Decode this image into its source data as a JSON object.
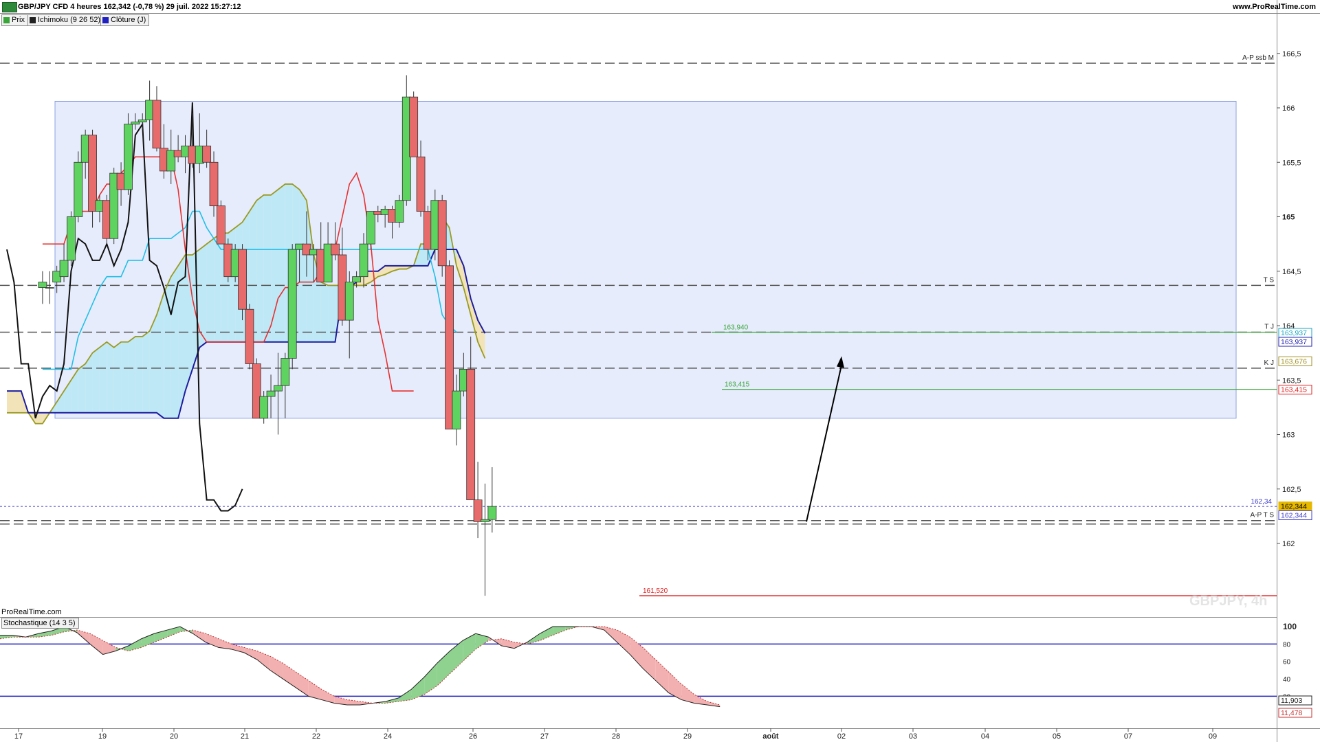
{
  "header": {
    "title": "GBP/JPY CFD 4 heures 162,342 (-0,78 %) 29 juil. 2022 15:27:12",
    "brand": "www.ProRealTime.com",
    "legend": [
      {
        "label": "Prix",
        "color": "#3aa63a"
      },
      {
        "label": "Ichimoku (9 26 52)",
        "color": "#222222"
      },
      {
        "label": "Clôture (J)",
        "color": "#2020c0"
      }
    ]
  },
  "footer": {
    "prorealtime": "ProRealTime.com",
    "watermark": "GBPJPY, 4h"
  },
  "stochastic": {
    "label": "Stochastique (14 3 5)",
    "levels": {
      "upper": 80,
      "lower": 20
    },
    "ticks": [
      "100",
      "80",
      "60",
      "40",
      "20"
    ],
    "value_k": "11,903",
    "value_d": "11,478",
    "k": [
      90,
      90,
      88,
      92,
      95,
      100,
      93,
      80,
      68,
      72,
      78,
      86,
      92,
      96,
      100,
      92,
      82,
      76,
      74,
      70,
      62,
      50,
      40,
      30,
      20,
      16,
      12,
      10,
      10,
      12,
      14,
      18,
      28,
      42,
      58,
      72,
      84,
      92,
      88,
      78,
      75,
      82,
      92,
      100,
      100,
      100,
      100,
      96,
      82,
      68,
      52,
      38,
      24,
      16,
      12,
      10,
      8
    ],
    "d": [
      86,
      88,
      88,
      88,
      90,
      94,
      96,
      92,
      84,
      76,
      72,
      76,
      82,
      88,
      94,
      96,
      92,
      86,
      80,
      76,
      72,
      66,
      58,
      48,
      38,
      28,
      20,
      16,
      14,
      12,
      12,
      14,
      16,
      22,
      32,
      46,
      60,
      74,
      84,
      86,
      82,
      80,
      84,
      90,
      96,
      100,
      100,
      100,
      96,
      88,
      76,
      62,
      48,
      34,
      22,
      14,
      10
    ]
  },
  "price_axis": {
    "ticks": [
      "166,5",
      "166",
      "165,5",
      "165",
      "164,5",
      "164",
      "163,5",
      "163",
      "162,5",
      "162"
    ],
    "bold_ticks": [
      "165"
    ]
  },
  "x_axis": {
    "labels": [
      "17",
      "19",
      "20",
      "21",
      "22",
      "24",
      "26",
      "27",
      "28",
      "29",
      "août",
      "02",
      "03",
      "04",
      "05",
      "07",
      "09"
    ]
  },
  "chart_data": {
    "type": "candlestick",
    "symbol": "GBP/JPY",
    "timeframe": "4 heures",
    "ylim": [
      161.4,
      166.85
    ],
    "candles": [
      {
        "o": 164.35,
        "h": 164.5,
        "l": 164.2,
        "c": 164.4
      },
      {
        "o": 164.35,
        "h": 164.5,
        "l": 164.2,
        "c": 164.35
      },
      {
        "o": 164.4,
        "h": 164.55,
        "l": 164.3,
        "c": 164.5
      },
      {
        "o": 164.45,
        "h": 164.75,
        "l": 164.4,
        "c": 164.6
      },
      {
        "o": 164.6,
        "h": 165.05,
        "l": 164.55,
        "c": 165.0
      },
      {
        "o": 165.0,
        "h": 165.6,
        "l": 164.95,
        "c": 165.5
      },
      {
        "o": 165.5,
        "h": 165.8,
        "l": 165.35,
        "c": 165.75
      },
      {
        "o": 165.75,
        "h": 165.8,
        "l": 164.9,
        "c": 165.05
      },
      {
        "o": 165.05,
        "h": 165.2,
        "l": 164.95,
        "c": 165.15
      },
      {
        "o": 165.15,
        "h": 165.2,
        "l": 164.75,
        "c": 164.8
      },
      {
        "o": 164.8,
        "h": 165.45,
        "l": 164.75,
        "c": 165.4
      },
      {
        "o": 165.4,
        "h": 165.5,
        "l": 165.1,
        "c": 165.25
      },
      {
        "o": 165.25,
        "h": 165.95,
        "l": 165.2,
        "c": 165.85
      },
      {
        "o": 165.85,
        "h": 165.95,
        "l": 165.8,
        "c": 165.87
      },
      {
        "o": 165.87,
        "h": 165.95,
        "l": 165.8,
        "c": 165.89
      },
      {
        "o": 165.89,
        "h": 166.25,
        "l": 165.7,
        "c": 166.07
      },
      {
        "o": 166.07,
        "h": 166.2,
        "l": 165.6,
        "c": 165.63
      },
      {
        "o": 165.63,
        "h": 165.85,
        "l": 165.35,
        "c": 165.42
      },
      {
        "o": 165.42,
        "h": 165.8,
        "l": 165.3,
        "c": 165.61
      },
      {
        "o": 165.61,
        "h": 165.75,
        "l": 165.5,
        "c": 165.55
      },
      {
        "o": 165.55,
        "h": 165.75,
        "l": 165.4,
        "c": 165.65
      },
      {
        "o": 165.65,
        "h": 165.95,
        "l": 165.45,
        "c": 165.49
      },
      {
        "o": 165.49,
        "h": 165.95,
        "l": 165.4,
        "c": 165.65
      },
      {
        "o": 165.65,
        "h": 165.8,
        "l": 165.45,
        "c": 165.5
      },
      {
        "o": 165.5,
        "h": 165.6,
        "l": 165.0,
        "c": 165.1
      },
      {
        "o": 165.1,
        "h": 165.15,
        "l": 164.75,
        "c": 164.75
      },
      {
        "o": 164.75,
        "h": 164.8,
        "l": 164.4,
        "c": 164.45
      },
      {
        "o": 164.45,
        "h": 164.75,
        "l": 164.4,
        "c": 164.7
      },
      {
        "o": 164.7,
        "h": 164.75,
        "l": 164.05,
        "c": 164.15
      },
      {
        "o": 164.15,
        "h": 164.2,
        "l": 163.6,
        "c": 163.65
      },
      {
        "o": 163.65,
        "h": 163.7,
        "l": 163.15,
        "c": 163.15
      },
      {
        "o": 163.15,
        "h": 163.4,
        "l": 163.1,
        "c": 163.35
      },
      {
        "o": 163.35,
        "h": 163.55,
        "l": 163.15,
        "c": 163.4
      },
      {
        "o": 163.4,
        "h": 163.75,
        "l": 163.0,
        "c": 163.45
      },
      {
        "o": 163.45,
        "h": 163.75,
        "l": 163.15,
        "c": 163.7
      },
      {
        "o": 163.7,
        "h": 164.75,
        "l": 163.6,
        "c": 164.7
      },
      {
        "o": 164.7,
        "h": 164.75,
        "l": 164.4,
        "c": 164.75
      },
      {
        "o": 164.75,
        "h": 165.05,
        "l": 164.45,
        "c": 164.65
      },
      {
        "o": 164.65,
        "h": 164.75,
        "l": 164.4,
        "c": 164.7
      },
      {
        "o": 164.7,
        "h": 164.95,
        "l": 164.5,
        "c": 164.4
      },
      {
        "o": 164.4,
        "h": 164.95,
        "l": 164.4,
        "c": 164.75
      },
      {
        "o": 164.75,
        "h": 164.95,
        "l": 164.6,
        "c": 164.65
      },
      {
        "o": 164.65,
        "h": 164.9,
        "l": 164.0,
        "c": 164.05
      },
      {
        "o": 164.05,
        "h": 164.5,
        "l": 163.7,
        "c": 164.4
      },
      {
        "o": 164.4,
        "h": 164.5,
        "l": 164.35,
        "c": 164.45
      },
      {
        "o": 164.45,
        "h": 164.85,
        "l": 164.35,
        "c": 164.75
      },
      {
        "o": 164.75,
        "h": 165.05,
        "l": 164.7,
        "c": 165.05
      },
      {
        "o": 165.05,
        "h": 165.1,
        "l": 164.95,
        "c": 165.02
      },
      {
        "o": 165.02,
        "h": 165.1,
        "l": 164.9,
        "c": 165.07
      },
      {
        "o": 165.07,
        "h": 165.1,
        "l": 164.8,
        "c": 164.95
      },
      {
        "o": 164.95,
        "h": 165.2,
        "l": 164.9,
        "c": 165.15
      },
      {
        "o": 165.15,
        "h": 166.3,
        "l": 165.1,
        "c": 166.1
      },
      {
        "o": 166.1,
        "h": 166.15,
        "l": 165.55,
        "c": 165.55
      },
      {
        "o": 165.55,
        "h": 165.7,
        "l": 165.0,
        "c": 165.05
      },
      {
        "o": 165.05,
        "h": 165.1,
        "l": 164.6,
        "c": 164.7
      },
      {
        "o": 164.7,
        "h": 165.25,
        "l": 164.6,
        "c": 165.15
      },
      {
        "o": 165.15,
        "h": 165.2,
        "l": 164.45,
        "c": 164.55
      },
      {
        "o": 164.55,
        "h": 164.6,
        "l": 163.05,
        "c": 163.05
      },
      {
        "o": 163.05,
        "h": 163.55,
        "l": 162.9,
        "c": 163.4
      },
      {
        "o": 163.4,
        "h": 163.75,
        "l": 163.35,
        "c": 163.6
      },
      {
        "o": 163.6,
        "h": 163.9,
        "l": 162.4,
        "c": 162.4
      },
      {
        "o": 162.4,
        "h": 162.75,
        "l": 162.05,
        "c": 162.2
      },
      {
        "o": 162.2,
        "h": 162.55,
        "l": 161.52,
        "c": 162.22
      },
      {
        "o": 162.22,
        "h": 162.7,
        "l": 162.1,
        "c": 162.34
      }
    ],
    "tenkan": [
      164.75,
      164.75,
      164.75,
      164.75,
      164.95,
      165.05,
      165.05,
      165.05,
      165.2,
      165.3,
      165.3,
      165.4,
      165.47,
      165.55,
      165.55,
      165.55,
      165.55,
      165.55,
      165.55,
      165.25,
      164.7,
      164.25,
      163.95,
      163.85,
      163.85,
      163.85,
      163.85,
      163.85,
      163.85,
      163.85,
      163.85,
      163.85,
      164.0,
      164.25,
      164.35,
      164.35,
      164.4,
      164.4,
      164.4,
      164.5,
      164.6,
      164.7,
      165.0,
      165.3,
      165.4,
      165.2,
      164.75,
      164.05,
      163.75,
      163.4,
      163.4,
      163.4,
      163.4
    ],
    "kijun": [
      163.6,
      163.6,
      163.6,
      163.6,
      163.6,
      163.9,
      164.05,
      164.2,
      164.35,
      164.45,
      164.45,
      164.45,
      164.6,
      164.6,
      164.6,
      164.8,
      164.8,
      164.8,
      164.8,
      164.85,
      164.9,
      165.05,
      165.05,
      164.9,
      164.8,
      164.7,
      164.7,
      164.7,
      164.7,
      164.7,
      164.7,
      164.7,
      164.7,
      164.7,
      164.7,
      164.7,
      164.7,
      164.7,
      164.7,
      164.7,
      164.7,
      164.7,
      164.7,
      164.7,
      164.7,
      164.7,
      164.7,
      164.7,
      164.7,
      164.7,
      164.7,
      164.7,
      164.7,
      164.7,
      164.7,
      164.45,
      164.1,
      164.0,
      163.94
    ],
    "chikou": [
      164.7,
      164.4,
      163.65,
      163.65,
      163.15,
      163.35,
      163.45,
      163.4,
      163.65,
      164.5,
      164.8,
      164.75,
      164.6,
      164.6,
      164.75,
      164.55,
      164.7,
      164.95,
      165.75,
      165.85,
      164.6,
      164.55,
      164.35,
      164.1,
      164.4,
      164.45,
      166.05,
      163.1,
      162.4,
      162.4,
      162.3,
      162.3,
      162.35,
      162.5
    ],
    "ssa": [
      163.2,
      163.2,
      163.2,
      163.2,
      163.1,
      163.1,
      163.2,
      163.3,
      163.4,
      163.5,
      163.6,
      163.65,
      163.75,
      163.8,
      163.85,
      163.8,
      163.85,
      163.85,
      163.9,
      163.9,
      163.95,
      164.1,
      164.3,
      164.45,
      164.55,
      164.65,
      164.65,
      164.7,
      164.75,
      164.8,
      164.85,
      164.85,
      164.9,
      164.95,
      165.05,
      165.15,
      165.2,
      165.2,
      165.25,
      165.3,
      165.3,
      165.25,
      165.15,
      164.65,
      164.4,
      164.37,
      164.37,
      164.37,
      164.37,
      164.37,
      164.37,
      164.4,
      164.45,
      164.47,
      164.5,
      164.52,
      164.52,
      164.55,
      164.75,
      164.75,
      164.95,
      165.0,
      164.9,
      164.55,
      164.35,
      164.1,
      163.85,
      163.7
    ],
    "ssb": [
      163.4,
      163.4,
      163.4,
      163.2,
      163.2,
      163.2,
      163.2,
      163.2,
      163.2,
      163.2,
      163.2,
      163.2,
      163.2,
      163.2,
      163.2,
      163.2,
      163.2,
      163.2,
      163.2,
      163.2,
      163.2,
      163.2,
      163.15,
      163.15,
      163.15,
      163.4,
      163.6,
      163.8,
      163.85,
      163.85,
      163.85,
      163.85,
      163.85,
      163.85,
      163.85,
      163.85,
      163.85,
      163.85,
      163.85,
      163.85,
      163.85,
      163.85,
      163.85,
      163.85,
      163.85,
      163.85,
      163.85,
      164.3,
      164.35,
      164.4,
      164.5,
      164.5,
      164.5,
      164.55,
      164.55,
      164.55,
      164.55,
      164.55,
      164.55,
      164.55,
      164.7,
      164.7,
      164.7,
      164.7,
      164.55,
      164.25,
      164.05,
      163.93
    ],
    "levels": [
      {
        "label": "A-P ssb M",
        "value": 166.41,
        "style": "dash",
        "color": "#555555"
      },
      {
        "label": "T S",
        "value": 164.37,
        "style": "dash",
        "color": "#555555"
      },
      {
        "label": "T J",
        "value": 163.94,
        "style": "dash",
        "color": "#555555"
      },
      {
        "label": "K J",
        "value": 163.61,
        "style": "dash",
        "color": "#555555"
      },
      {
        "label": "A-P T S",
        "value": 162.21,
        "style": "dash",
        "color": "#555555"
      }
    ],
    "annotations": [
      {
        "text": "163,940",
        "value": 163.94,
        "color": "#3aa63a"
      },
      {
        "text": "163,415",
        "value": 163.415,
        "color": "#3aa63a"
      },
      {
        "text": "161,520",
        "value": 161.52,
        "color": "#e02020"
      },
      {
        "text": "162,34",
        "value": 162.34,
        "color": "#4040d0"
      }
    ],
    "price_tags": [
      {
        "text": "163,937",
        "value": 163.937,
        "color": "#16a6c6"
      },
      {
        "text": "163,937",
        "value": 163.937,
        "color": "#2020b0"
      },
      {
        "text": "163,676",
        "value": 163.676,
        "color": "#a09020"
      },
      {
        "text": "163,415",
        "value": 163.415,
        "color": "#e02020"
      },
      {
        "text": "162,344",
        "value": 162.344,
        "color": "#e6b800"
      },
      {
        "text": "162,344",
        "value": 162.344,
        "color": "#4040d0"
      }
    ],
    "zone": {
      "top": 166.06,
      "bottom": 163.15
    },
    "arrow": {
      "from_value": 162.2,
      "to_value": 163.7
    }
  }
}
